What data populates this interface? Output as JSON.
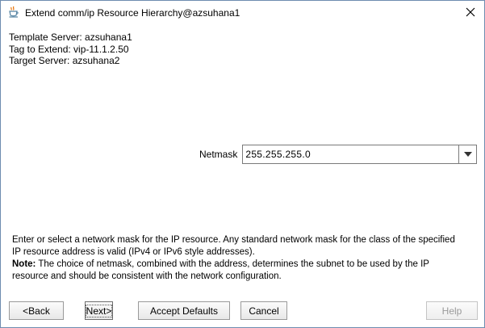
{
  "window": {
    "title": "Extend comm/ip Resource Hierarchy@azsuhana1"
  },
  "info": {
    "template_server": "Template Server: azsuhana1",
    "tag_to_extend": "Tag to Extend: vip-11.1.2.50",
    "target_server": "Target Server: azsuhana2"
  },
  "netmask": {
    "label": "Netmask",
    "value": "255.255.255.0"
  },
  "help": {
    "description": "Enter or select a network mask for the IP resource. Any standard network mask for the class of the specified IP resource address is valid (IPv4 or IPv6 style addresses).",
    "note_label": "Note:",
    "note_text": " The choice of netmask, combined with the address, determines the subnet to be used by the IP resource and should be consistent with the network configuration."
  },
  "buttons": {
    "back": "<Back",
    "next": "Next>",
    "accept_defaults": "Accept Defaults",
    "cancel": "Cancel",
    "help": "Help"
  },
  "icons": {
    "app": "java-cup-icon",
    "close": "close-icon",
    "dropdown": "chevron-down-icon"
  },
  "colors": {
    "window_border": "#6e8cb0",
    "disabled_text": "#9a9a9a"
  }
}
